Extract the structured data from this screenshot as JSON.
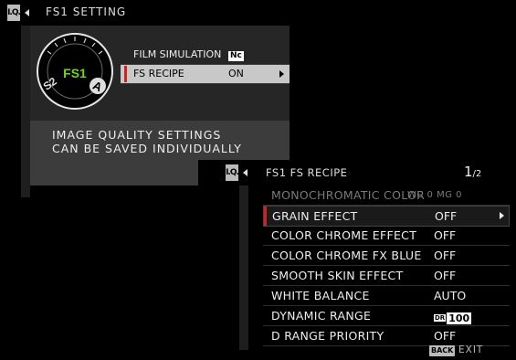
{
  "panel1": {
    "tag": "I.Q.",
    "title": "FS1 SETTING",
    "dial": {
      "center": "FS1",
      "left": "S2",
      "right": "A"
    },
    "menu": [
      {
        "label": "FILM SIMULATION",
        "value_icon": "Nc"
      },
      {
        "label": "FS RECIPE",
        "value": "ON"
      }
    ],
    "info_line1": "IMAGE QUALITY SETTINGS",
    "info_line2": "CAN BE SAVED INDIVIDUALLY"
  },
  "panel2": {
    "tag": "I.Q.",
    "title": "FS1  FS RECIPE",
    "page_current": "1",
    "page_total": "/2",
    "items": [
      {
        "label": "MONOCHROMATIC COLOR",
        "value": "WC  0  MG  0"
      },
      {
        "label": "GRAIN EFFECT",
        "value": "OFF"
      },
      {
        "label": "COLOR CHROME EFFECT",
        "value": "OFF"
      },
      {
        "label": "COLOR CHROME FX BLUE",
        "value": "OFF"
      },
      {
        "label": "SMOOTH SKIN EFFECT",
        "value": "OFF"
      },
      {
        "label": "WHITE BALANCE",
        "value": "AUTO"
      },
      {
        "label": "DYNAMIC RANGE",
        "value_prefix": "DR",
        "value": "100"
      },
      {
        "label": "D RANGE PRIORITY",
        "value": "OFF"
      }
    ],
    "back_label": "BACK",
    "exit_label": "EXIT"
  },
  "colors": {
    "accent_red": "#d42020",
    "dial_green": "#6fd51c",
    "highlight": "#c8c8c8"
  }
}
